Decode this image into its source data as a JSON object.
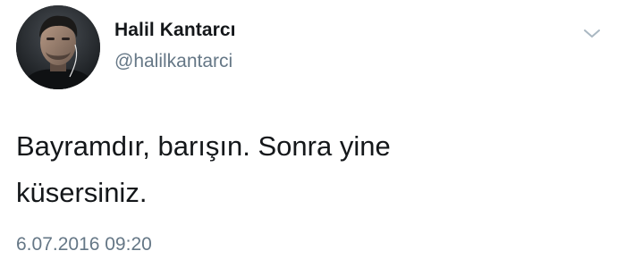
{
  "tweet": {
    "display_name": "Halil Kantarcı",
    "handle": "@halilkantarci",
    "text_line1": "Bayramdır, barışın. Sonra yine",
    "text_line2": "küsersiniz.",
    "timestamp": "6.07.2016 09:20",
    "avatar_icon": "profile-photo",
    "menu_icon": "chevron-down-icon"
  },
  "colors": {
    "text": "#14171a",
    "secondary": "#657786",
    "caret": "#aab8c2",
    "background": "#ffffff"
  }
}
